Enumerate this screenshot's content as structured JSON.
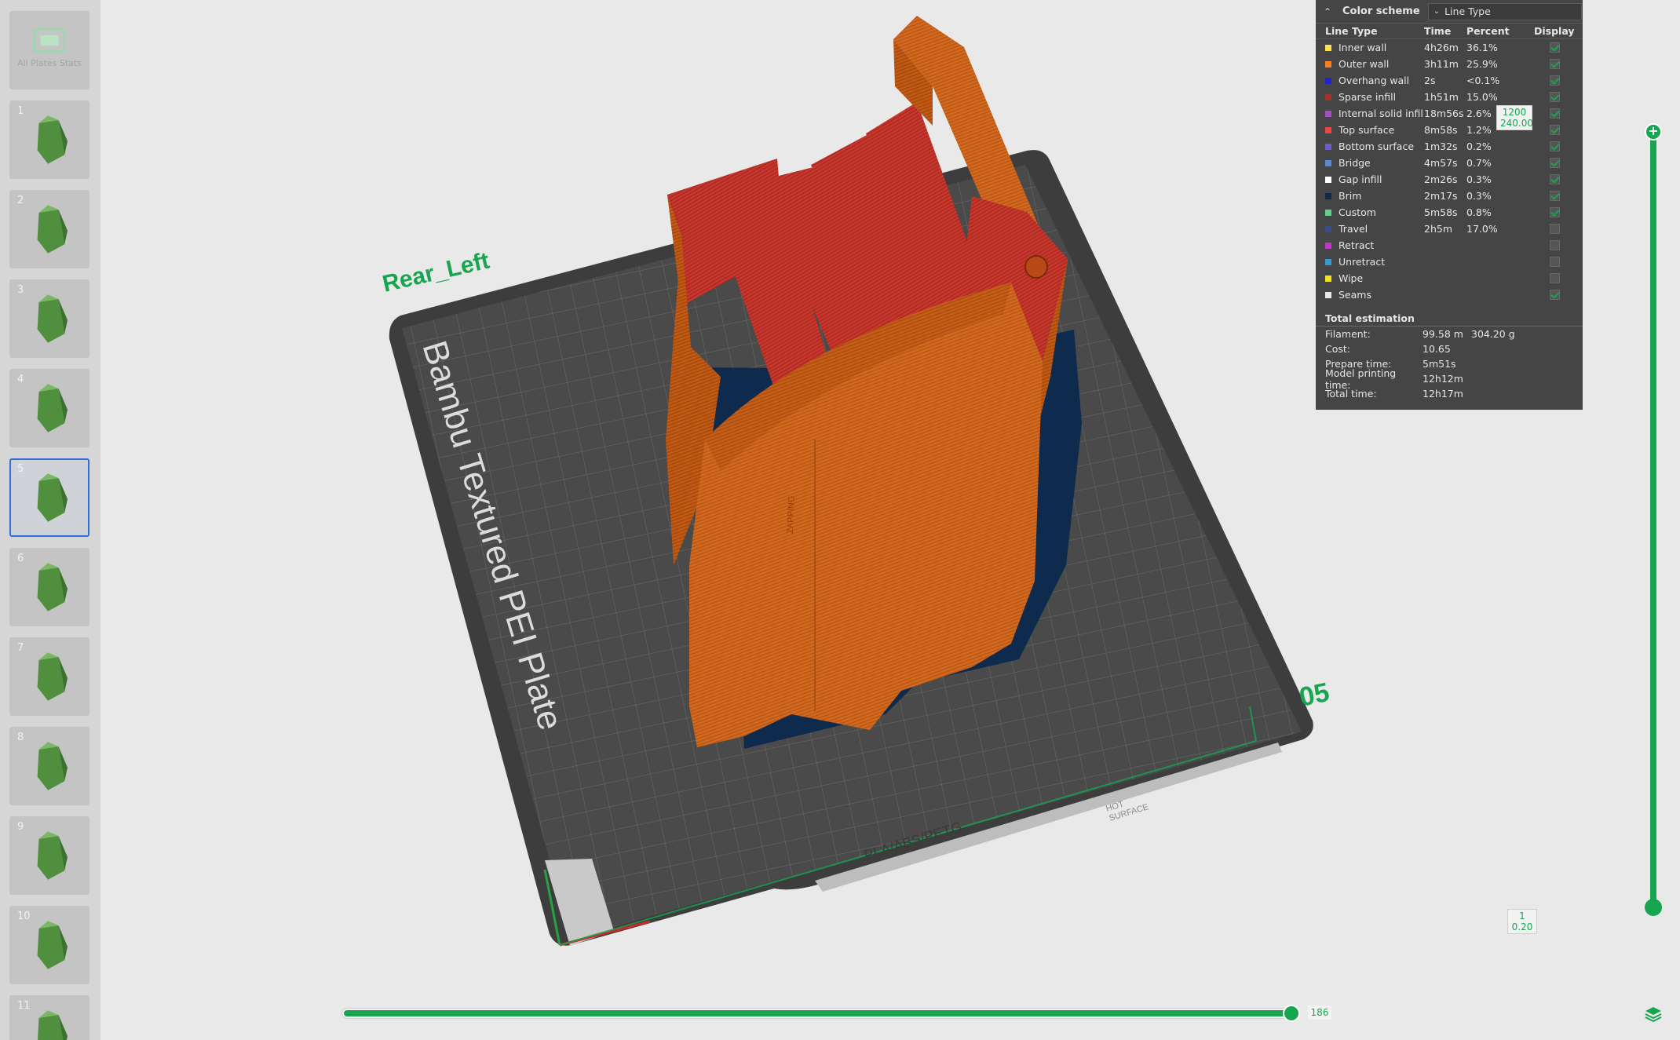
{
  "sidebar": {
    "all_plates_label": "All Plates Stats",
    "plates": [
      {
        "number": "1",
        "selected": false
      },
      {
        "number": "2",
        "selected": false
      },
      {
        "number": "3",
        "selected": false
      },
      {
        "number": "4",
        "selected": false
      },
      {
        "number": "5",
        "selected": true
      },
      {
        "number": "6",
        "selected": false
      },
      {
        "number": "7",
        "selected": false
      },
      {
        "number": "8",
        "selected": false
      },
      {
        "number": "9",
        "selected": false
      },
      {
        "number": "10",
        "selected": false
      },
      {
        "number": "11",
        "selected": false
      }
    ]
  },
  "viewport": {
    "plate_name": "Bambu Textured PEI Plate",
    "camera_label": "Rear_Left",
    "plate_number": "05",
    "plate_material": "PLA/ABS/PETG",
    "hot_surface_line1": "HOT",
    "hot_surface_line2": "SURFACE",
    "model_text": "ZAPPING"
  },
  "legend": {
    "title": "Color scheme",
    "scheme": "Line Type",
    "columns": {
      "type": "Line Type",
      "time": "Time",
      "percent": "Percent",
      "display": "Display"
    },
    "rows": [
      {
        "name": "Inner wall",
        "color": "#ffe14d",
        "time": "4h26m",
        "percent": "36.1%",
        "display": true
      },
      {
        "name": "Outer wall",
        "color": "#ff7f21",
        "time": "3h11m",
        "percent": "25.9%",
        "display": true
      },
      {
        "name": "Overhang wall",
        "color": "#1f24c8",
        "time": "2s",
        "percent": "<0.1%",
        "display": true
      },
      {
        "name": "Sparse infill",
        "color": "#a6302c",
        "time": "1h51m",
        "percent": "15.0%",
        "display": true
      },
      {
        "name": "Internal solid infill",
        "color": "#a64dc4",
        "time": "18m56s",
        "percent": "2.6%",
        "display": true
      },
      {
        "name": "Top surface",
        "color": "#ee4444",
        "time": "8m58s",
        "percent": "1.2%",
        "display": true
      },
      {
        "name": "Bottom surface",
        "color": "#6a5fc0",
        "time": "1m32s",
        "percent": "0.2%",
        "display": true
      },
      {
        "name": "Bridge",
        "color": "#5a8ad0",
        "time": "4m57s",
        "percent": "0.7%",
        "display": true
      },
      {
        "name": "Gap infill",
        "color": "#ffffff",
        "time": "2m26s",
        "percent": "0.3%",
        "display": true
      },
      {
        "name": "Brim",
        "color": "#0e2a4d",
        "time": "2m17s",
        "percent": "0.3%",
        "display": true
      },
      {
        "name": "Custom",
        "color": "#5fd08c",
        "time": "5m58s",
        "percent": "0.8%",
        "display": true
      },
      {
        "name": "Travel",
        "color": "#3a4a8a",
        "time": "2h5m",
        "percent": "17.0%",
        "display": false
      },
      {
        "name": "Retract",
        "color": "#c036c8",
        "time": "",
        "percent": "",
        "display": false
      },
      {
        "name": "Unretract",
        "color": "#3a9ad0",
        "time": "",
        "percent": "",
        "display": false
      },
      {
        "name": "Wipe",
        "color": "#f2e21e",
        "time": "",
        "percent": "",
        "display": false
      },
      {
        "name": "Seams",
        "color": "#e8e8e8",
        "time": "",
        "percent": "",
        "display": true
      }
    ],
    "estimation_title": "Total estimation",
    "estimation": [
      {
        "label": "Filament:",
        "value": "99.58 m",
        "value2": "304.20 g"
      },
      {
        "label": "Cost:",
        "value": "10.65",
        "value2": ""
      },
      {
        "label": "Prepare time:",
        "value": "5m51s",
        "value2": ""
      },
      {
        "label": "Model printing time:",
        "value": "12h12m",
        "value2": ""
      },
      {
        "label": "Total time:",
        "value": "12h17m",
        "value2": ""
      }
    ]
  },
  "layer_slider": {
    "top_layer": "1200",
    "top_height": "240.00",
    "bottom_layer": "1",
    "bottom_height": "0.20"
  },
  "move_slider": {
    "value": "186"
  }
}
